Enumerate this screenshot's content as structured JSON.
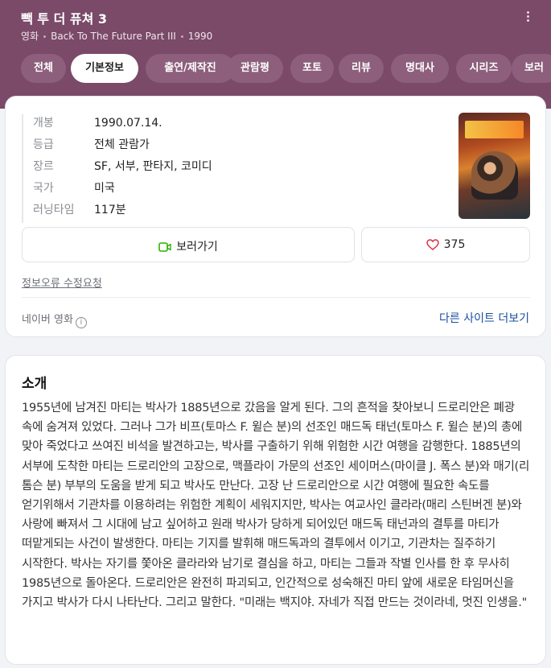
{
  "header": {
    "title": "빽 투 더 퓨쳐 3",
    "category": "영화",
    "original_title": "Back To The Future Part III",
    "year": "1990"
  },
  "tabs": [
    {
      "label": "전체",
      "active": false
    },
    {
      "label": "기본정보",
      "active": true
    },
    {
      "label": "출연/제작진",
      "active": false
    },
    {
      "label": "관람평",
      "active": false
    },
    {
      "label": "포토",
      "active": false
    },
    {
      "label": "리뷰",
      "active": false
    },
    {
      "label": "명대사",
      "active": false
    },
    {
      "label": "시리즈",
      "active": false
    },
    {
      "label": "보러",
      "active": false
    }
  ],
  "info": [
    {
      "key": "개봉",
      "value": "1990.07.14."
    },
    {
      "key": "등급",
      "value": "전체 관람가"
    },
    {
      "key": "장르",
      "value": "SF, 서부, 판타지, 코미디"
    },
    {
      "key": "국가",
      "value": "미국"
    },
    {
      "key": "러닝타임",
      "value": "117분"
    }
  ],
  "actions": {
    "watch_label": "보러가기",
    "like_count": "375"
  },
  "fix_link": "정보오류 수정요청",
  "source": {
    "label": "네이버 영화",
    "info_icon": "i",
    "other_sites": "다른 사이트 더보기"
  },
  "intro": {
    "heading": "소개",
    "text": "1955년에 남겨진 마티는 박사가 1885년으로 갔음을 알게 된다. 그의 흔적을 찾아보니 드로리안은 폐광 속에 숨겨져 있었다. 그러나 그가 비프(토마스 F. 윌슨 분)의 선조인 매드독 태넌(토마스 F. 윌슨 분)의 총에 맞아 죽었다고 쓰여진 비석을 발견하고는, 박사를 구출하기 위해 위험한 시간 여행을 감행한다. 1885년의 서부에 도착한 마티는 드로리안의 고장으로, 맥플라이 가문의 선조인 세이머스(마이클 J. 폭스 분)와 매기(리 톰슨 분) 부부의 도움을 받게 되고 박사도 만난다. 고장 난 드로리안으로 시간 여행에 필요한 속도를 얻기위해서 기관차를 이용하려는 위험한 계획이 세워지지만, 박사는 여교사인 클라라(매리 스틴버겐 분)와 사랑에 빠져서 그 시대에 남고 싶어하고 원래 박사가 당하게 되어있던 매드독 태넌과의 결투를 마티가 떠맡게되는 사건이 발생한다. 마티는 기지를 발휘해 매드독과의 결투에서 이기고, 기관차는 질주하기 시작한다. 박사는 자기를 쫓아온 클라라와 남기로 결심을 하고, 마티는 그들과 작별 인사를 한 후 무사히 1985년으로 돌아온다. 드로리안은 완전히 파괴되고, 인간적으로 성숙해진 마티 앞에 새로운 타임머신을 가지고 박사가 다시 나타난다. 그리고 말한다. \"미래는 백지야. 자네가 직접 만드는 것이라네, 멋진 인생을.\""
  },
  "colors": {
    "header_bg": "#7a4a68",
    "tab_bg": "#8d5f7c",
    "link": "#1a4fa0",
    "watch_icon": "#2db400",
    "heart_icon": "#e0303f"
  },
  "icons": [
    "more-vertical-icon",
    "video-play-icon",
    "heart-icon",
    "info-icon"
  ]
}
